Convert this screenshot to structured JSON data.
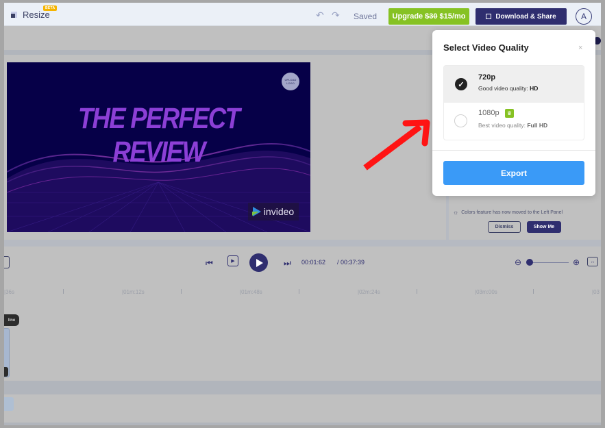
{
  "topbar": {
    "resize_label": "Resize",
    "beta_badge": "BETA",
    "undo_icon": "↶",
    "redo_icon": "↷",
    "saved_status": "Saved",
    "upgrade_label": "Upgrade",
    "upgrade_old_price": "$30",
    "upgrade_new_price": "$15/mo",
    "download_label": "Download & Share",
    "avatar_initial": "A"
  },
  "video": {
    "title": "THE PERFECT REVIEW",
    "upload_logo_text": "UPLOAD LOGO",
    "watermark": "invideo",
    "title_color": "#8c3fd6",
    "bg_color": "#060048"
  },
  "side_panel": {
    "tip_text": "Colors feature has now moved to the Left Panel",
    "tip_icon": "☼",
    "dismiss_label": "Dismiss",
    "show_me_label": "Show Me"
  },
  "player": {
    "prev_icon": "⏮",
    "loop_icon": "▶",
    "next_icon": "⏭",
    "current_time": "00:01:62",
    "duration": "/ 00:37:39",
    "zoom_out_icon": "⊖",
    "zoom_in_icon": "⊕",
    "fit_icon": "↔",
    "zoom_level": 0
  },
  "ruler": {
    "ticks": [
      "|36s",
      "|01m:12s",
      "|01m:48s",
      "|02m:24s",
      "|03m:00s",
      "|03"
    ]
  },
  "timeline": {
    "track_label": "line"
  },
  "modal": {
    "title": "Select Video Quality",
    "close_icon": "×",
    "options": [
      {
        "name": "720p",
        "desc_prefix": "Good video quality:",
        "desc_bold": "HD",
        "selected": true
      },
      {
        "name": "1080p",
        "desc_prefix": "Best video quality:",
        "desc_bold": "Full HD",
        "selected": false,
        "premium_icon": "♛"
      }
    ],
    "export_label": "Export"
  },
  "colors": {
    "accent_navy": "#2f2e6f",
    "upgrade_green": "#86c223",
    "export_blue": "#3a9af7",
    "arrow_red": "#ff1414"
  }
}
